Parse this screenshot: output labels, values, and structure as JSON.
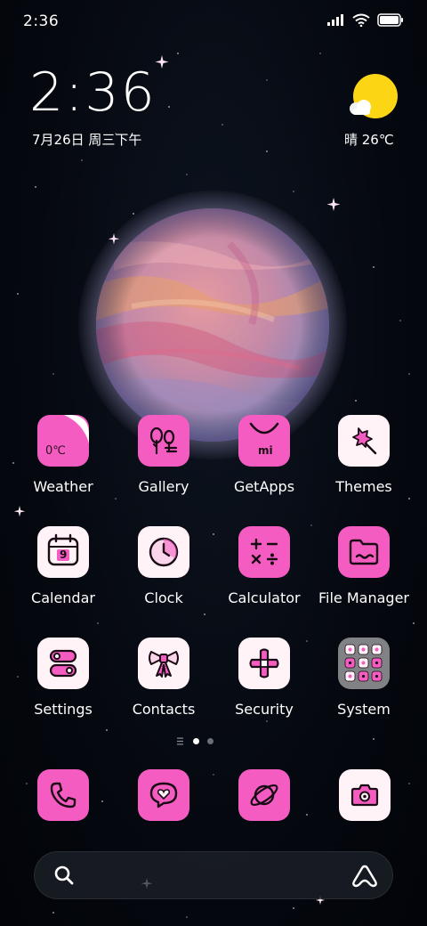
{
  "status_bar": {
    "time": "2:36",
    "icons": [
      "signal-icon",
      "wifi-icon",
      "battery-icon"
    ]
  },
  "clock_widget": {
    "time": "2:36",
    "date": "7月26日 周三下午"
  },
  "weather_widget": {
    "condition": "晴 26℃",
    "icon": "sun-cloud-icon"
  },
  "wallpaper": {
    "subject": "planet-image"
  },
  "apps": [
    {
      "label": "Weather",
      "icon": "weather-app-icon",
      "icon_text": "0℃"
    },
    {
      "label": "Gallery",
      "icon": "trees-icon"
    },
    {
      "label": "GetApps",
      "icon": "bag-icon",
      "icon_text": "mi"
    },
    {
      "label": "Themes",
      "icon": "brush-icon"
    },
    {
      "label": "Calendar",
      "icon": "calendar-icon",
      "icon_text": "9"
    },
    {
      "label": "Clock",
      "icon": "clock-icon"
    },
    {
      "label": "Calculator",
      "icon": "calculator-icon"
    },
    {
      "label": "File Manager",
      "icon": "folder-icon"
    },
    {
      "label": "Settings",
      "icon": "toggles-icon"
    },
    {
      "label": "Contacts",
      "icon": "bow-icon"
    },
    {
      "label": "Security",
      "icon": "cross-icon"
    },
    {
      "label": "System",
      "icon": "folder-grid-icon"
    }
  ],
  "page_indicator": {
    "pages": 2,
    "current": 1
  },
  "dock": [
    {
      "icon": "phone-icon"
    },
    {
      "icon": "message-heart-icon"
    },
    {
      "icon": "planet-icon"
    },
    {
      "icon": "camera-icon"
    }
  ],
  "search_bar": {
    "left_icon": "search-icon",
    "right_icon": "assistant-icon"
  },
  "colors": {
    "accent": "#f45cc2",
    "tile_white": "#fff3f8",
    "folder_grey": "#808285",
    "sun": "#fcd614"
  }
}
